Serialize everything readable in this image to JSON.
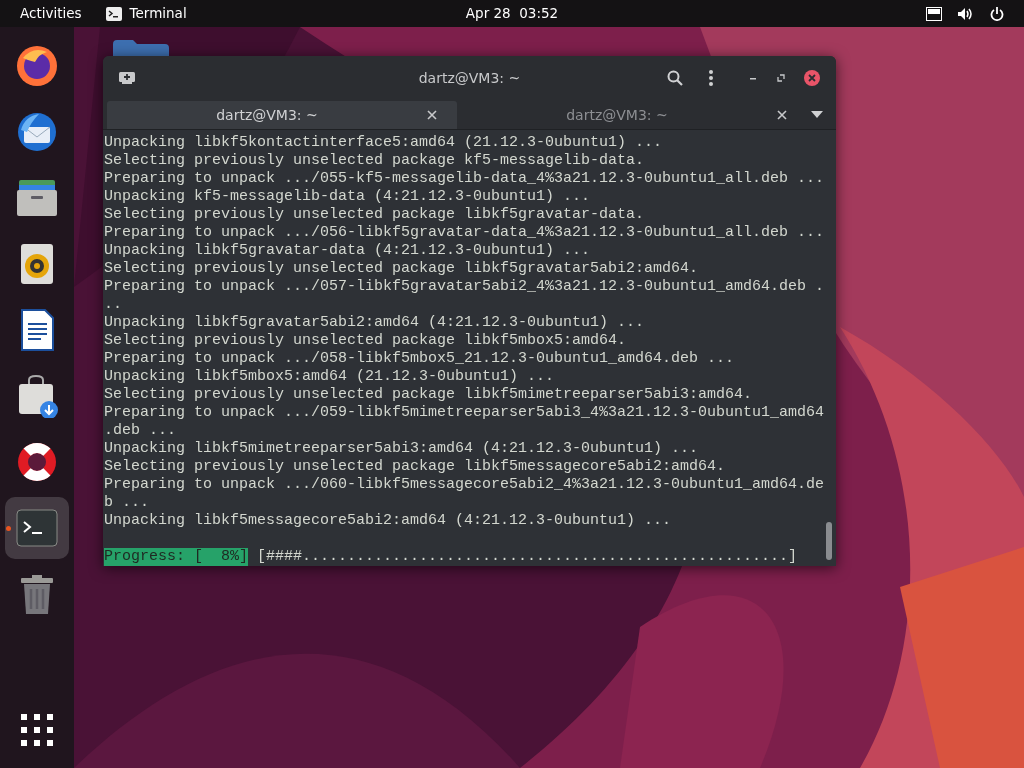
{
  "top_bar": {
    "activities": "Activities",
    "app": "Terminal",
    "clock": "Apr 28  03:52"
  },
  "dock": [
    {
      "kind": "globe",
      "running": false,
      "selected": false
    },
    {
      "kind": "bird",
      "running": false,
      "selected": false
    },
    {
      "kind": "drawer",
      "running": false,
      "selected": false
    },
    {
      "kind": "speaker",
      "running": false,
      "selected": false
    },
    {
      "kind": "document",
      "running": false,
      "selected": false
    },
    {
      "kind": "bag",
      "running": false,
      "selected": false
    },
    {
      "kind": "lifebuoy",
      "running": false,
      "selected": false
    },
    {
      "kind": "terminal",
      "running": true,
      "selected": true
    },
    {
      "kind": "trash",
      "running": false,
      "selected": false
    }
  ],
  "window": {
    "title": "dartz@VM3: ~",
    "tabs": [
      {
        "label": "dartz@VM3: ~",
        "selected": true
      },
      {
        "label": "dartz@VM3: ~",
        "selected": false
      }
    ],
    "lines": [
      "Unpacking libkf5kontactinterface5:amd64 (21.12.3-0ubuntu1) ...",
      "Selecting previously unselected package kf5-messagelib-data.",
      "Preparing to unpack .../055-kf5-messagelib-data_4%3a21.12.3-0ubuntu1_all.deb ...",
      "Unpacking kf5-messagelib-data (4:21.12.3-0ubuntu1) ...",
      "Selecting previously unselected package libkf5gravatar-data.",
      "Preparing to unpack .../056-libkf5gravatar-data_4%3a21.12.3-0ubuntu1_all.deb ...",
      "Unpacking libkf5gravatar-data (4:21.12.3-0ubuntu1) ...",
      "Selecting previously unselected package libkf5gravatar5abi2:amd64.",
      "Preparing to unpack .../057-libkf5gravatar5abi2_4%3a21.12.3-0ubuntu1_amd64.deb .",
      "..",
      "Unpacking libkf5gravatar5abi2:amd64 (4:21.12.3-0ubuntu1) ...",
      "Selecting previously unselected package libkf5mbox5:amd64.",
      "Preparing to unpack .../058-libkf5mbox5_21.12.3-0ubuntu1_amd64.deb ...",
      "Unpacking libkf5mbox5:amd64 (21.12.3-0ubuntu1) ...",
      "Selecting previously unselected package libkf5mimetreeparser5abi3:amd64.",
      "Preparing to unpack .../059-libkf5mimetreeparser5abi3_4%3a21.12.3-0ubuntu1_amd64",
      ".deb ...",
      "Unpacking libkf5mimetreeparser5abi3:amd64 (4:21.12.3-0ubuntu1) ...",
      "Selecting previously unselected package libkf5messagecore5abi2:amd64.",
      "Preparing to unpack .../060-libkf5messagecore5abi2_4%3a21.12.3-0ubuntu1_amd64.de",
      "b ...",
      "Unpacking libkf5messagecore5abi2:amd64 (4:21.12.3-0ubuntu1) ..."
    ],
    "progress": {
      "label": "Progress: [  8%]",
      "bar": "[####......................................................]"
    }
  }
}
